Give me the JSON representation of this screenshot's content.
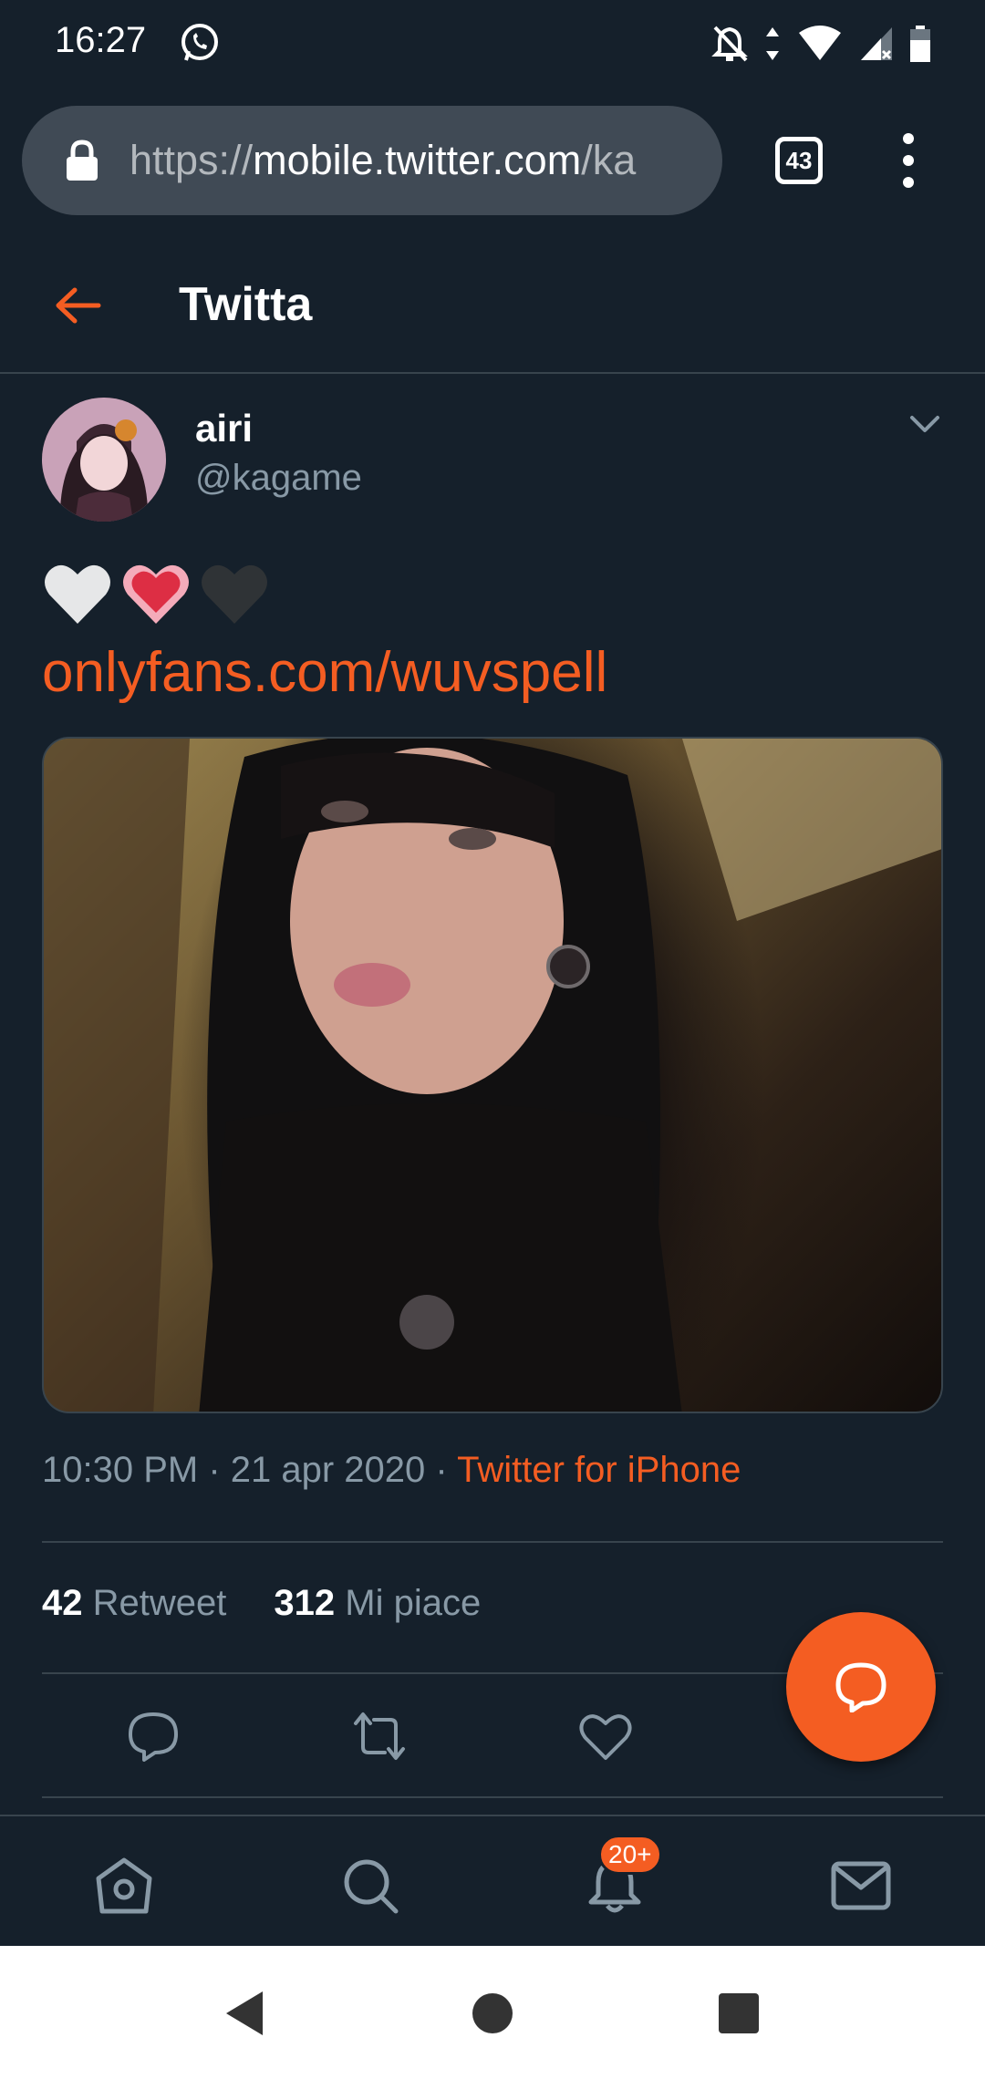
{
  "status_bar": {
    "time": "16:27",
    "icons": [
      "whatsapp-icon",
      "notifications-off-icon",
      "data-arrows-icon",
      "wifi-icon",
      "signal-icon",
      "battery-icon"
    ]
  },
  "browser": {
    "url_scheme": "https://",
    "url_host": "mobile.twitter.com",
    "url_path": "/ka",
    "tab_count": "43"
  },
  "header": {
    "title": "Twitta"
  },
  "tweet": {
    "author_name": "airi",
    "author_handle": "@kagame",
    "text_emoji": [
      "white-heart",
      "growing-heart",
      "black-heart"
    ],
    "link": "onlyfans.com/wuvspell",
    "time": "10:30 PM",
    "date": "21 apr 2020",
    "source": "Twitter for iPhone",
    "retweets_count": "42",
    "retweets_label": "Retweet",
    "likes_count": "312",
    "likes_label": "Mi piace"
  },
  "bottom_nav": {
    "notifications_badge": "20+"
  },
  "colors": {
    "background": "#15202b",
    "accent": "#f45d22",
    "secondary_text": "#8899a6",
    "divider": "#38444d"
  }
}
